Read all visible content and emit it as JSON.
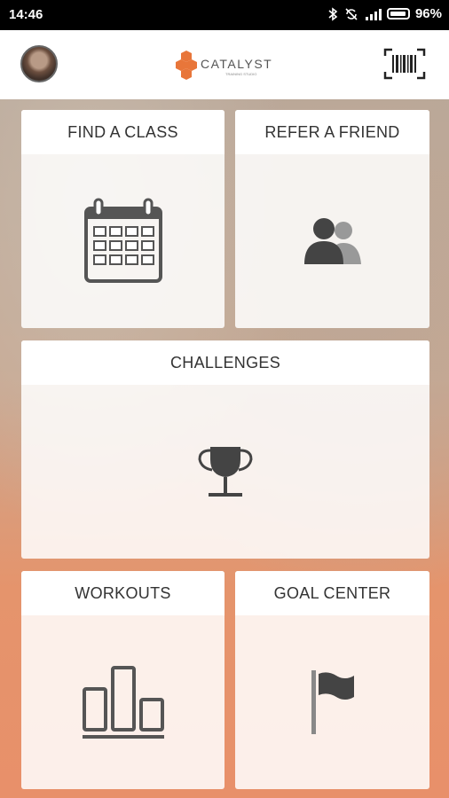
{
  "status_bar": {
    "time": "14:46",
    "battery": "96%",
    "icons": [
      "bluetooth-icon",
      "sync-off-icon",
      "signal-icon",
      "battery-icon"
    ]
  },
  "header": {
    "logo_text": "CATALYST",
    "logo_subtext": "TRAINING STUDIO",
    "brand_color": "#e8763a",
    "icons": [
      "avatar",
      "barcode-scan-icon"
    ]
  },
  "tiles": [
    {
      "label": "FIND A CLASS",
      "icon": "calendar-icon"
    },
    {
      "label": "REFER A FRIEND",
      "icon": "people-icon"
    },
    {
      "label": "CHALLENGES",
      "icon": "trophy-icon"
    },
    {
      "label": "WORKOUTS",
      "icon": "bar-chart-icon"
    },
    {
      "label": "GOAL CENTER",
      "icon": "flag-icon"
    }
  ]
}
